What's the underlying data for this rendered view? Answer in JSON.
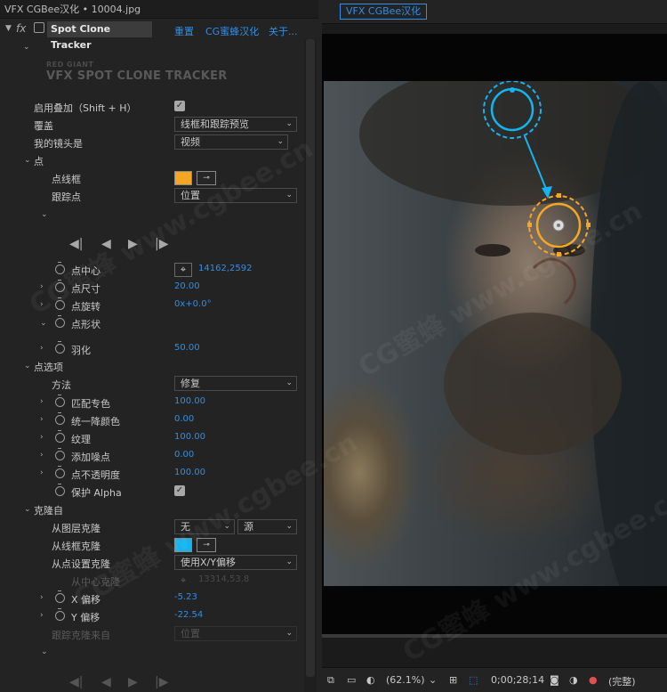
{
  "window": {
    "title": "VFX CGBee汉化 • 10004.jpg"
  },
  "effect": {
    "fx": "fx",
    "name": "Spot Clone Tracker",
    "links": [
      "重置",
      "CG蜜蜂汉化",
      "关于..."
    ],
    "logo_line1": "RED GIANT",
    "logo_line2": "VFX SPOT CLONE TRACKER"
  },
  "props": {
    "enable_overlay": "启用叠加（Shift + H）",
    "overlay": {
      "label": "覆盖",
      "value": "线框和跟踪预览"
    },
    "lens": {
      "label": "我的镜头是",
      "value": "视频"
    },
    "spot": "点",
    "spot_frame": "点线框",
    "track_point": {
      "label": "跟踪点",
      "value": "位置"
    },
    "spot_center": {
      "label": "点中心",
      "value": "14162,2592"
    },
    "spot_size": {
      "label": "点尺寸",
      "value": "20.00"
    },
    "spot_rotation": {
      "label": "点旋转",
      "value": "0x+0.0°"
    },
    "spot_shape": "点形状",
    "feather": {
      "label": "羽化",
      "value": "50.00"
    },
    "spot_options": "点选项",
    "method": {
      "label": "方法",
      "value": "修复"
    },
    "match_color": {
      "label": "匹配专色",
      "value": "100.00"
    },
    "uniform_degrain": {
      "label": "统一降颜色",
      "value": "0.00"
    },
    "texture": {
      "label": "纹理",
      "value": "100.00"
    },
    "add_noise": {
      "label": "添加噪点",
      "value": "0.00"
    },
    "spot_opacity": {
      "label": "点不透明度",
      "value": "100.00"
    },
    "preserve_alpha": "保护 Alpha",
    "clone_from": "克隆自",
    "from_layer": {
      "label": "从图层克隆",
      "value1": "无",
      "value2": "源"
    },
    "from_frame": "从线框克隆",
    "from_point": {
      "label": "从点设置克隆",
      "value": "使用X/Y偏移"
    },
    "from_center": {
      "label": "从中心克隆",
      "value": "13314,53.8"
    },
    "x_offset": {
      "label": "X 偏移",
      "value": "-5.23"
    },
    "y_offset": {
      "label": "Y 偏移",
      "value": "-22.54"
    },
    "track_clone": {
      "label": "跟踪克隆来自",
      "value": "位置"
    }
  },
  "colors": {
    "spot_frame_color": "#f5a623",
    "clone_frame_color": "#14b4f0",
    "accent": "#2f8ee8"
  },
  "comp": {
    "tab": "VFX CGBee汉化",
    "zoom": "(62.1%)",
    "timecode": "0;00;28;14",
    "quality": "(完整)"
  },
  "watermark": "CG蜜蜂 www.cgbee.cn"
}
